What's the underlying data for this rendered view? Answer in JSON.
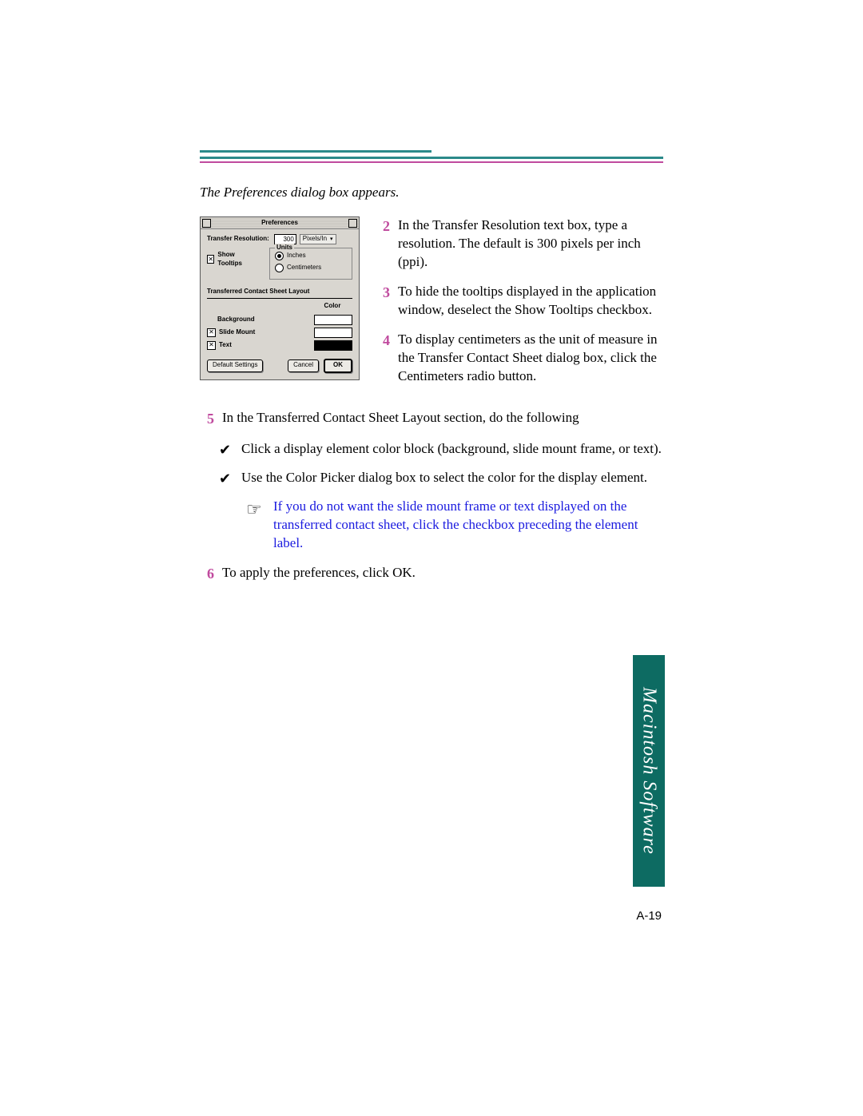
{
  "intro": "The Preferences dialog box appears.",
  "steps": {
    "s2": "In the Transfer Resolution text box, type a resolution. The default is 300 pixels per inch (ppi).",
    "s3": "To hide the tooltips displayed in the application window, deselect the Show Tooltips checkbox.",
    "s4": "To display centimeters as the unit of measure in the Transfer Contact Sheet dialog box, click the Centimeters radio button.",
    "s5": "In the Transferred Contact Sheet Layout section, do the following",
    "b1": "Click a display element color block (background, slide mount frame, or text).",
    "b2": "Use the Color Picker dialog box to select the color for the display element.",
    "note": "If you do not want the slide mount frame or text displayed on the transferred contact sheet, click the checkbox preceding the element label.",
    "s6": "To apply the preferences, click OK."
  },
  "nums": {
    "n2": "2",
    "n3": "3",
    "n4": "4",
    "n5": "5",
    "n6": "6"
  },
  "side_tab": "Macintosh Software",
  "page_number": "A-19",
  "dialog": {
    "title": "Preferences",
    "transfer_resolution_label": "Transfer Resolution:",
    "resolution_value": "300",
    "resolution_unit": "Pixels/In",
    "show_tooltips_label": "Show Tooltips",
    "units_legend": "Units",
    "units_inches": "Inches",
    "units_cm": "Centimeters",
    "layout_header": "Transferred Contact Sheet Layout",
    "color_header": "Color",
    "bg_label": "Background",
    "slide_label": "Slide Mount",
    "text_label": "Text",
    "default_btn": "Default Settings",
    "cancel_btn": "Cancel",
    "ok_btn": "OK"
  }
}
